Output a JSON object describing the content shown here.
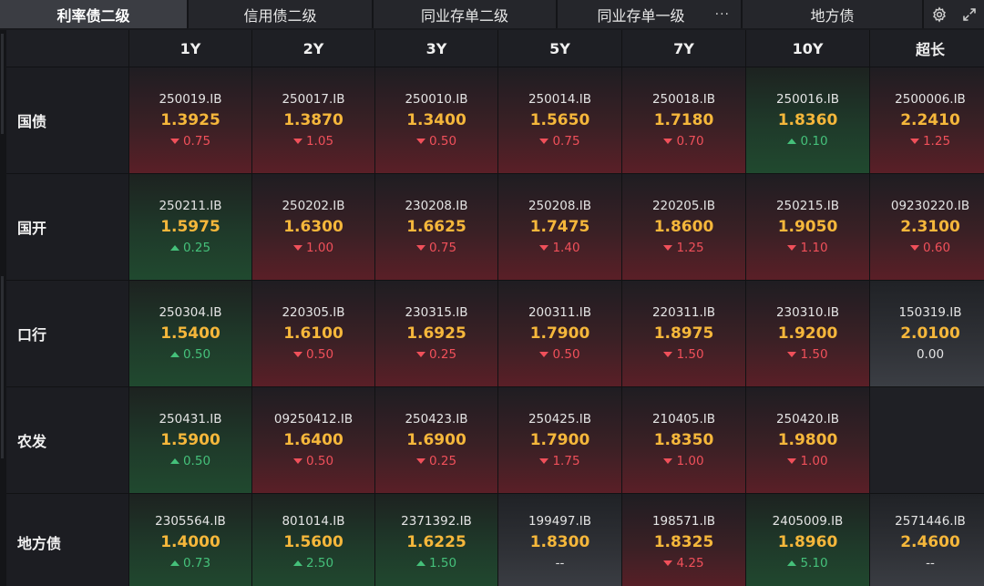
{
  "tabs": [
    {
      "label": "利率债二级",
      "active": true
    },
    {
      "label": "信用债二级",
      "active": false
    },
    {
      "label": "同业存单二级",
      "active": false
    },
    {
      "label": "同业存单一级",
      "active": false,
      "has_more": true
    },
    {
      "label": "地方债",
      "active": false
    }
  ],
  "more_glyph": "···",
  "icons": {
    "settings": "gear-icon",
    "expand": "expand-icon"
  },
  "columns": [
    "1Y",
    "2Y",
    "3Y",
    "5Y",
    "7Y",
    "10Y",
    "超长"
  ],
  "colors": {
    "up": "#45c07a",
    "down": "#f0505a",
    "yield": "#f5b73b"
  },
  "rows": [
    {
      "label": "国债",
      "cells": [
        {
          "code": "250019.IB",
          "yield": "1.3925",
          "change": "0.75",
          "dir": "down"
        },
        {
          "code": "250017.IB",
          "yield": "1.3870",
          "change": "1.05",
          "dir": "down"
        },
        {
          "code": "250010.IB",
          "yield": "1.3400",
          "change": "0.50",
          "dir": "down"
        },
        {
          "code": "250014.IB",
          "yield": "1.5650",
          "change": "0.75",
          "dir": "down"
        },
        {
          "code": "250018.IB",
          "yield": "1.7180",
          "change": "0.70",
          "dir": "down"
        },
        {
          "code": "250016.IB",
          "yield": "1.8360",
          "change": "0.10",
          "dir": "up"
        },
        {
          "code": "2500006.IB",
          "yield": "2.2410",
          "change": "1.25",
          "dir": "down"
        }
      ]
    },
    {
      "label": "国开",
      "cells": [
        {
          "code": "250211.IB",
          "yield": "1.5975",
          "change": "0.25",
          "dir": "up"
        },
        {
          "code": "250202.IB",
          "yield": "1.6300",
          "change": "1.00",
          "dir": "down"
        },
        {
          "code": "230208.IB",
          "yield": "1.6625",
          "change": "0.75",
          "dir": "down"
        },
        {
          "code": "250208.IB",
          "yield": "1.7475",
          "change": "1.40",
          "dir": "down"
        },
        {
          "code": "220205.IB",
          "yield": "1.8600",
          "change": "1.25",
          "dir": "down"
        },
        {
          "code": "250215.IB",
          "yield": "1.9050",
          "change": "1.10",
          "dir": "down"
        },
        {
          "code": "09230220.IB",
          "yield": "2.3100",
          "change": "0.60",
          "dir": "down"
        }
      ]
    },
    {
      "label": "口行",
      "cells": [
        {
          "code": "250304.IB",
          "yield": "1.5400",
          "change": "0.50",
          "dir": "up"
        },
        {
          "code": "220305.IB",
          "yield": "1.6100",
          "change": "0.50",
          "dir": "down"
        },
        {
          "code": "230315.IB",
          "yield": "1.6925",
          "change": "0.25",
          "dir": "down"
        },
        {
          "code": "200311.IB",
          "yield": "1.7900",
          "change": "0.50",
          "dir": "down"
        },
        {
          "code": "220311.IB",
          "yield": "1.8975",
          "change": "1.50",
          "dir": "down"
        },
        {
          "code": "230310.IB",
          "yield": "1.9200",
          "change": "1.50",
          "dir": "down"
        },
        {
          "code": "150319.IB",
          "yield": "2.0100",
          "change": "0.00",
          "dir": "flat"
        }
      ]
    },
    {
      "label": "农发",
      "cells": [
        {
          "code": "250431.IB",
          "yield": "1.5900",
          "change": "0.50",
          "dir": "up"
        },
        {
          "code": "09250412.IB",
          "yield": "1.6400",
          "change": "0.50",
          "dir": "down"
        },
        {
          "code": "250423.IB",
          "yield": "1.6900",
          "change": "0.25",
          "dir": "down"
        },
        {
          "code": "250425.IB",
          "yield": "1.7900",
          "change": "1.75",
          "dir": "down"
        },
        {
          "code": "210405.IB",
          "yield": "1.8350",
          "change": "1.00",
          "dir": "down"
        },
        {
          "code": "250420.IB",
          "yield": "1.9800",
          "change": "1.00",
          "dir": "down"
        },
        {
          "code": "",
          "yield": "",
          "change": "",
          "dir": "empty"
        }
      ]
    },
    {
      "label": "地方债",
      "cells": [
        {
          "code": "2305564.IB",
          "yield": "1.4000",
          "change": "0.73",
          "dir": "up"
        },
        {
          "code": "801014.IB",
          "yield": "1.5600",
          "change": "2.50",
          "dir": "up"
        },
        {
          "code": "2371392.IB",
          "yield": "1.6225",
          "change": "1.50",
          "dir": "up"
        },
        {
          "code": "199497.IB",
          "yield": "1.8300",
          "change": "--",
          "dir": "flat"
        },
        {
          "code": "198571.IB",
          "yield": "1.8325",
          "change": "4.25",
          "dir": "down"
        },
        {
          "code": "2405009.IB",
          "yield": "1.8960",
          "change": "5.10",
          "dir": "up"
        },
        {
          "code": "2571446.IB",
          "yield": "2.4600",
          "change": "--",
          "dir": "flat"
        }
      ]
    }
  ]
}
